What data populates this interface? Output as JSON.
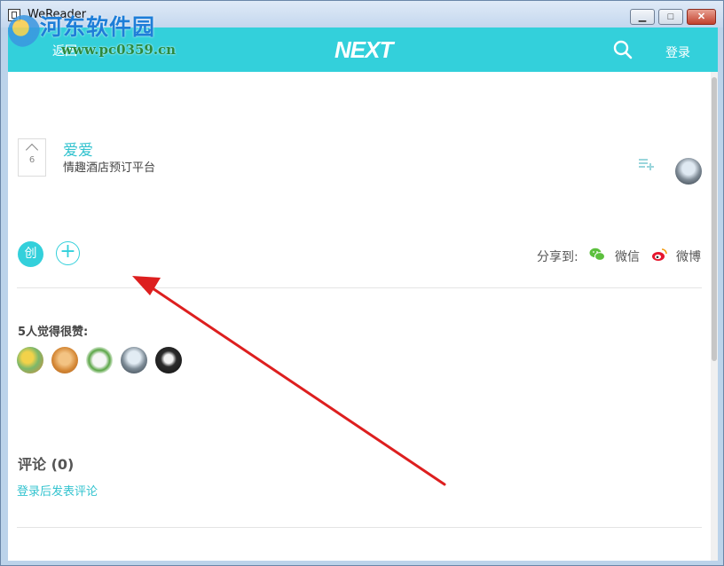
{
  "window": {
    "title": "WeReader",
    "minimize_glyph": "▁",
    "maximize_glyph": "□",
    "close_glyph": "✕"
  },
  "watermark": {
    "text_cn": "河东软件园",
    "url": "www.pc0359.cn"
  },
  "appbar": {
    "back_label": "返回",
    "brand": "NEXT",
    "login": "登录",
    "accent_color": "#33d0db"
  },
  "product": {
    "upvote_count": "6",
    "name": "爱爱",
    "tagline": "情趣酒店预订平台"
  },
  "actions": {
    "create_badge": "创",
    "add_glyph": "+",
    "share_label": "分享到:",
    "wechat": "微信",
    "weibo": "微博"
  },
  "likes": {
    "heading": "5人觉得很赞:"
  },
  "comments": {
    "heading": "评论 (0)",
    "login_prompt": "登录后发表评论"
  }
}
